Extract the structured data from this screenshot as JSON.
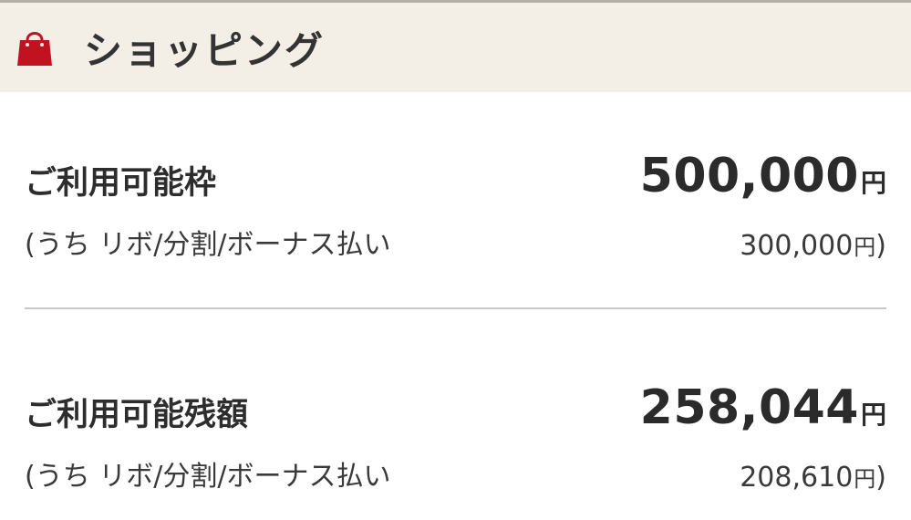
{
  "header": {
    "icon": "shopping-bag-icon",
    "title": "ショッピング",
    "colors": {
      "background": "#f4efe6",
      "icon": "#c0131f"
    }
  },
  "available_limit": {
    "label": "ご利用可能枠",
    "amount": "500,000",
    "unit": "円",
    "sub_label": "(うち リボ/分割/ボーナス払い",
    "sub_amount": "300,000",
    "sub_unit": "円",
    "sub_close": ")"
  },
  "available_balance": {
    "label": "ご利用可能残額",
    "amount": "258,044",
    "unit": "円",
    "sub_label": "(うち リボ/分割/ボーナス払い",
    "sub_amount": "208,610",
    "sub_unit": "円",
    "sub_close": ")"
  }
}
